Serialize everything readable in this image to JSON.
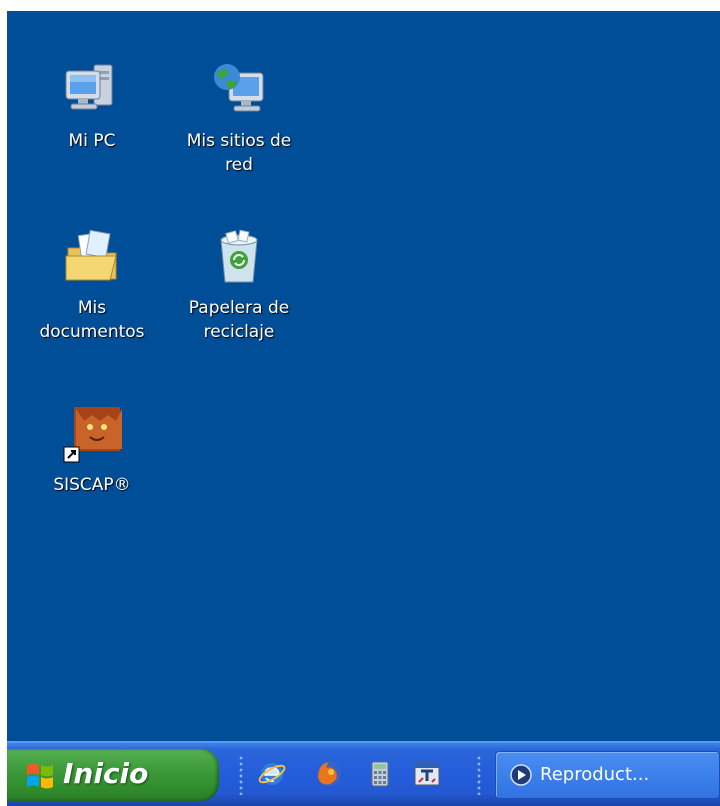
{
  "desktop": {
    "background": "#004e98",
    "icons": [
      {
        "label": "Mi PC",
        "icon": "computer-icon"
      },
      {
        "label": "Mis sitios de\nred",
        "icon": "network-places-icon"
      },
      {
        "label": "Mis\ndocumentos",
        "icon": "my-documents-icon"
      },
      {
        "label": "Papelera de\nreciclaje",
        "icon": "recycle-bin-icon"
      },
      {
        "label": "SISCAP®",
        "icon": "siscap-shortcut-icon"
      }
    ]
  },
  "taskbar": {
    "start_label": "Inicio",
    "quick_launch": [
      "internet-explorer-icon",
      "firefox-icon",
      "calculator-icon",
      "app-shortcut-icon"
    ],
    "tasks": [
      {
        "label": "Reproduct...",
        "icon": "media-player-icon"
      }
    ],
    "colors": {
      "taskbar": "#245edb",
      "start": "#3d9b3a"
    }
  }
}
